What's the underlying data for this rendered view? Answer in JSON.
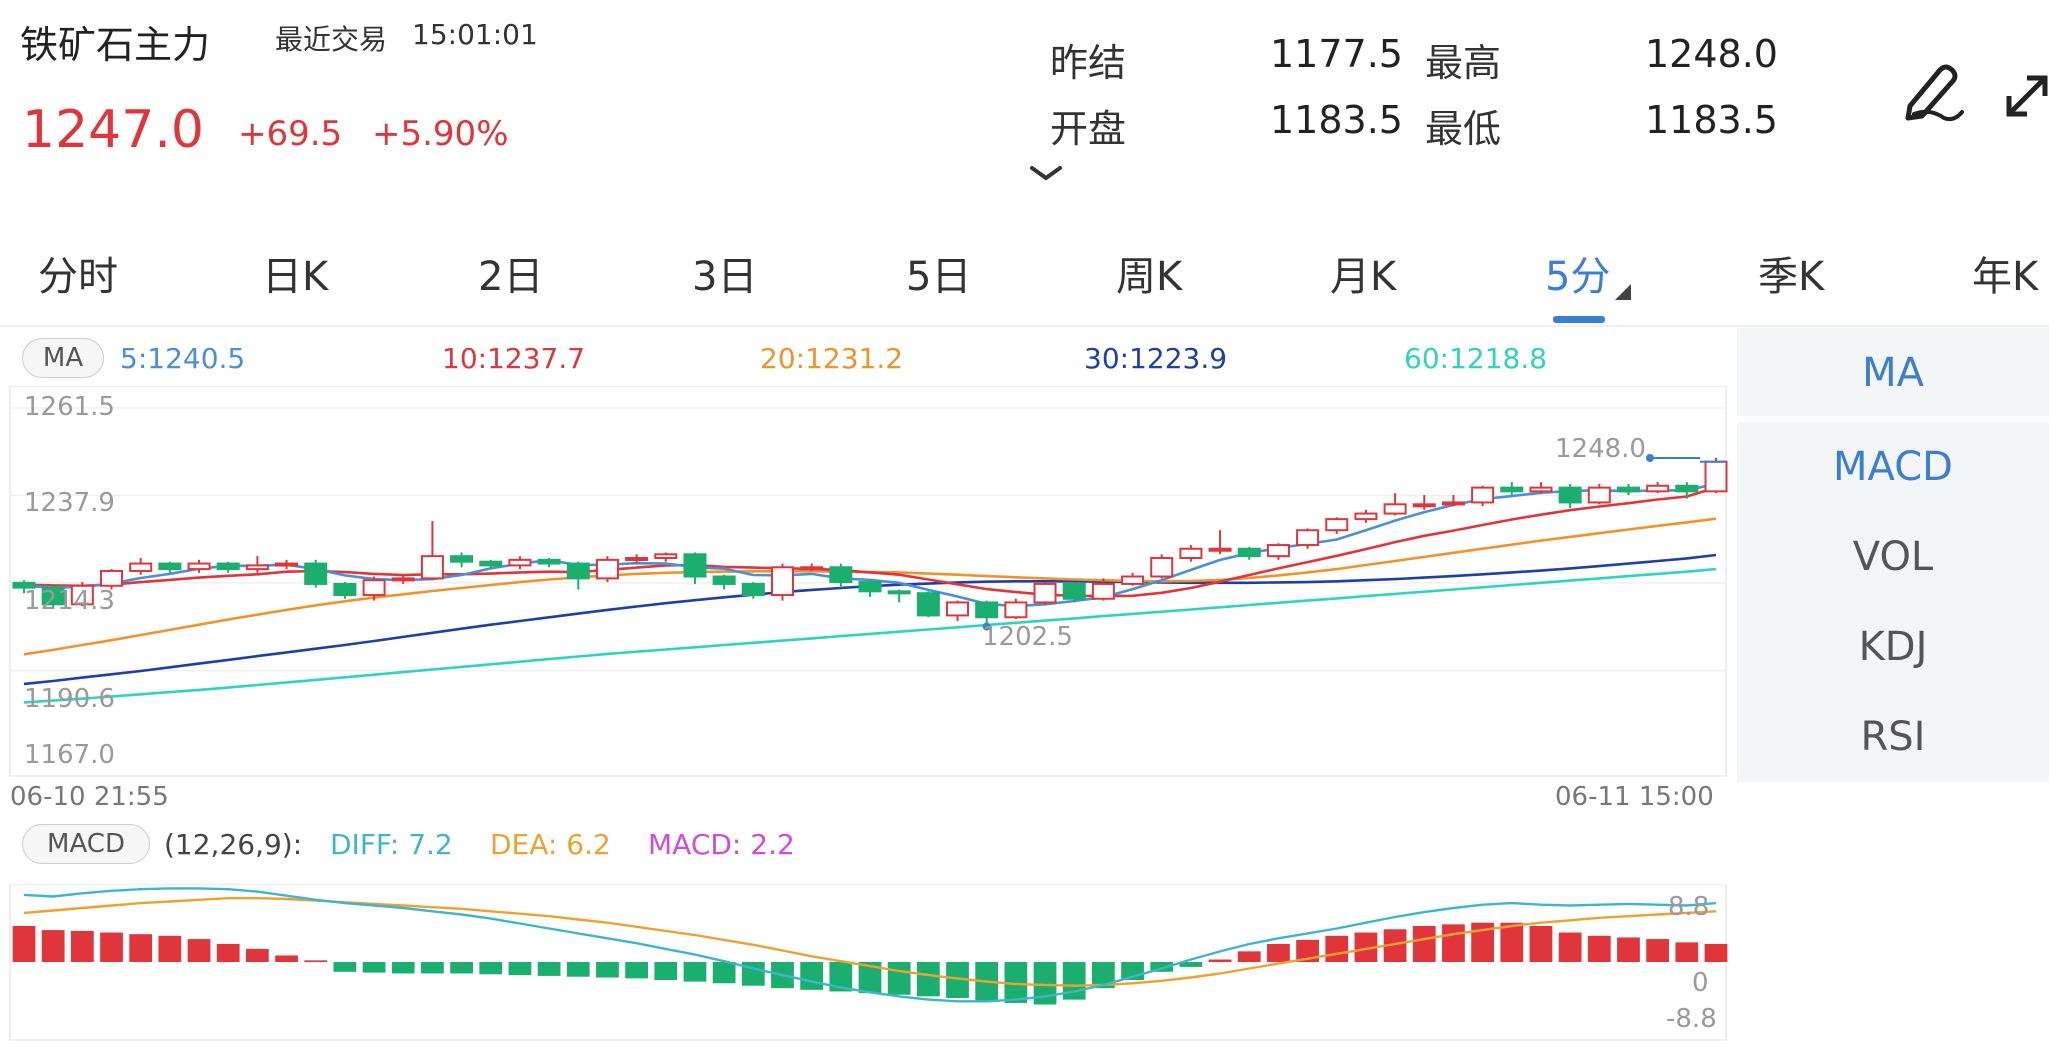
{
  "header": {
    "title": "铁矿石主力",
    "last_trade_label": "最近交易",
    "last_trade_time": "15:01:01",
    "price": "1247.0",
    "change": "+69.5",
    "change_pct": "+5.90%"
  },
  "stats": {
    "prev_settle_label": "昨结",
    "prev_settle": "1177.5",
    "high_label": "最高",
    "high": "1248.0",
    "open_label": "开盘",
    "open": "1183.5",
    "low_label": "最低",
    "low": "1183.5"
  },
  "tabs": [
    {
      "label": "分时"
    },
    {
      "label": "日K"
    },
    {
      "label": "2日"
    },
    {
      "label": "3日"
    },
    {
      "label": "5日"
    },
    {
      "label": "周K"
    },
    {
      "label": "月K"
    },
    {
      "label": "5分"
    },
    {
      "label": "季K"
    },
    {
      "label": "年K"
    }
  ],
  "active_tab": "5分",
  "indicators": {
    "main": [
      "MA"
    ],
    "sub": [
      "MACD",
      "VOL",
      "KDJ",
      "RSI"
    ]
  },
  "ma_legend": {
    "label": "MA",
    "ma5": "5:1240.5",
    "ma10": "10:1237.7",
    "ma20": "20:1231.2",
    "ma30": "30:1223.9",
    "ma60": "60:1218.8"
  },
  "price_axis": [
    "1261.5",
    "1237.9",
    "1214.3",
    "1190.6",
    "1167.0"
  ],
  "price_markers": {
    "high": "1248.0",
    "low": "1202.5"
  },
  "time_axis": {
    "start": "06-10 21:55",
    "end": "06-11 15:00"
  },
  "macd_legend": {
    "label": "MACD",
    "params": "(12,26,9):",
    "diff": "DIFF: 7.2",
    "dea": "DEA: 6.2",
    "macd": "MACD: 2.2"
  },
  "macd_axis": [
    "8.8",
    "0",
    "-8.8"
  ],
  "colors": {
    "up": "#e0353b",
    "down": "#1aae6f",
    "accent": "#3b7fd4",
    "ma5": "#4a90d9",
    "ma10": "#e0353b",
    "ma20": "#f0932b",
    "ma30": "#1f3fa8",
    "ma60": "#2dd4bf",
    "diff": "#3fb6c8",
    "dea": "#f0a030",
    "macd": "#d24ad6"
  },
  "chart_data": {
    "type": "candlestick",
    "price_ylim": [
      1167.0,
      1261.5
    ],
    "macd_ylim": [
      -8.8,
      8.8
    ],
    "candles": [
      [
        1214.3,
        1213.0,
        1215.0,
        1211.5
      ],
      [
        1213.0,
        1208.5,
        1213.5,
        1207.5
      ],
      [
        1208.5,
        1213.5,
        1214.5,
        1208.0
      ],
      [
        1213.5,
        1217.5,
        1218.0,
        1212.5
      ],
      [
        1217.5,
        1219.5,
        1221.0,
        1216.5
      ],
      [
        1219.5,
        1218.0,
        1220.0,
        1217.0
      ],
      [
        1218.0,
        1219.5,
        1220.5,
        1217.0
      ],
      [
        1219.5,
        1218.0,
        1220.0,
        1217.0
      ],
      [
        1218.0,
        1219.0,
        1221.5,
        1217.0
      ],
      [
        1219.0,
        1219.5,
        1220.5,
        1218.0
      ],
      [
        1219.5,
        1214.0,
        1220.5,
        1213.0
      ],
      [
        1214.0,
        1211.0,
        1214.5,
        1210.0
      ],
      [
        1211.0,
        1215.0,
        1216.0,
        1209.5
      ],
      [
        1215.0,
        1215.5,
        1216.5,
        1214.0
      ],
      [
        1215.5,
        1221.5,
        1231.0,
        1215.0
      ],
      [
        1221.5,
        1220.0,
        1222.5,
        1218.5
      ],
      [
        1220.0,
        1219.0,
        1220.5,
        1218.0
      ],
      [
        1219.0,
        1220.5,
        1221.5,
        1218.0
      ],
      [
        1220.5,
        1219.5,
        1221.0,
        1218.5
      ],
      [
        1219.5,
        1215.5,
        1220.0,
        1212.5
      ],
      [
        1215.5,
        1220.5,
        1221.5,
        1214.5
      ],
      [
        1220.5,
        1221.0,
        1222.0,
        1219.5
      ],
      [
        1221.0,
        1222.0,
        1222.5,
        1220.0
      ],
      [
        1222.0,
        1216.0,
        1222.5,
        1214.0
      ],
      [
        1216.0,
        1214.0,
        1216.5,
        1212.5
      ],
      [
        1214.0,
        1211.0,
        1214.5,
        1210.0
      ],
      [
        1211.0,
        1218.5,
        1219.5,
        1209.5
      ],
      [
        1218.5,
        1218.5,
        1219.5,
        1217.5
      ],
      [
        1218.5,
        1214.5,
        1219.5,
        1213.0
      ],
      [
        1214.5,
        1212.0,
        1215.0,
        1210.5
      ],
      [
        1212.0,
        1211.5,
        1212.5,
        1209.0
      ],
      [
        1211.5,
        1205.5,
        1212.0,
        1205.0
      ],
      [
        1205.5,
        1209.0,
        1209.5,
        1204.0
      ],
      [
        1209.0,
        1205.0,
        1209.5,
        1202.5
      ],
      [
        1205.0,
        1209.0,
        1210.0,
        1204.5
      ],
      [
        1209.0,
        1214.0,
        1214.5,
        1208.5
      ],
      [
        1214.0,
        1210.0,
        1214.5,
        1209.0
      ],
      [
        1210.0,
        1214.0,
        1215.5,
        1209.5
      ],
      [
        1214.0,
        1216.0,
        1217.0,
        1213.5
      ],
      [
        1216.0,
        1221.0,
        1222.0,
        1215.5
      ],
      [
        1221.0,
        1223.5,
        1224.5,
        1220.0
      ],
      [
        1223.5,
        1223.5,
        1228.5,
        1222.0
      ],
      [
        1223.5,
        1221.5,
        1224.0,
        1220.5
      ],
      [
        1221.5,
        1224.5,
        1225.0,
        1220.5
      ],
      [
        1224.5,
        1228.5,
        1229.0,
        1223.5
      ],
      [
        1228.5,
        1231.5,
        1232.0,
        1227.5
      ],
      [
        1231.5,
        1233.0,
        1234.0,
        1230.5
      ],
      [
        1233.0,
        1235.5,
        1238.5,
        1232.5
      ],
      [
        1235.5,
        1235.5,
        1238.0,
        1234.0
      ],
      [
        1235.5,
        1236.0,
        1238.0,
        1235.0
      ],
      [
        1236.0,
        1240.0,
        1240.5,
        1235.0
      ],
      [
        1240.0,
        1239.0,
        1241.5,
        1238.0
      ],
      [
        1239.0,
        1240.0,
        1241.5,
        1238.5
      ],
      [
        1240.0,
        1236.0,
        1241.0,
        1234.5
      ],
      [
        1236.0,
        1240.0,
        1241.0,
        1235.5
      ],
      [
        1240.0,
        1239.0,
        1241.0,
        1238.0
      ],
      [
        1239.0,
        1240.5,
        1241.5,
        1238.5
      ],
      [
        1240.5,
        1239.0,
        1241.5,
        1237.0
      ],
      [
        1239.0,
        1247.0,
        1248.0,
        1238.5
      ]
    ],
    "ma5": [
      1213.5,
      1213.0,
      1213.2,
      1214.1,
      1215.6,
      1216.7,
      1218.1,
      1218.9,
      1218.9,
      1219.2,
      1218.0,
      1216.3,
      1215.3,
      1215.0,
      1215.3,
      1216.4,
      1218.2,
      1219.5,
      1220.4,
      1219.1,
      1219.2,
      1219.6,
      1219.5,
      1218.5,
      1218.1,
      1216.4,
      1216.3,
      1216.7,
      1215.5,
      1215.1,
      1214.3,
      1212.4,
      1210.6,
      1208.6,
      1208.0,
      1208.5,
      1209.4,
      1210.4,
      1212.6,
      1215.0,
      1217.8,
      1220.5,
      1222.3,
      1223.7,
      1224.8,
      1226.0,
      1228.5,
      1231.1,
      1233.4,
      1235.3,
      1236.9,
      1237.7,
      1238.6,
      1239.1,
      1239.3,
      1239.0,
      1239.3,
      1239.2,
      1241.1
    ],
    "ma10": [
      1213.8,
      1213.6,
      1213.5,
      1213.8,
      1214.5,
      1215.1,
      1215.7,
      1216.2,
      1216.6,
      1217.3,
      1217.5,
      1217.2,
      1216.7,
      1216.4,
      1216.6,
      1216.6,
      1216.8,
      1217.1,
      1217.3,
      1217.2,
      1217.8,
      1218.4,
      1219.0,
      1219.1,
      1218.6,
      1218.4,
      1218.2,
      1218.1,
      1217.7,
      1217.1,
      1216.5,
      1215.2,
      1213.9,
      1212.6,
      1211.8,
      1211.1,
      1210.8,
      1210.7,
      1210.8,
      1211.6,
      1212.9,
      1214.6,
      1216.4,
      1218.2,
      1219.9,
      1221.6,
      1223.4,
      1225.3,
      1227.0,
      1228.4,
      1229.9,
      1231.4,
      1232.7,
      1233.9,
      1234.9,
      1235.8,
      1236.8,
      1237.6,
      1240.0
    ],
    "ma20": [
      1195.0,
      1196.2,
      1197.5,
      1198.8,
      1200.2,
      1201.6,
      1203.0,
      1204.4,
      1205.7,
      1207.0,
      1208.2,
      1209.3,
      1210.3,
      1211.2,
      1212.1,
      1212.9,
      1213.7,
      1214.5,
      1215.2,
      1215.8,
      1216.3,
      1216.7,
      1217.0,
      1217.2,
      1217.3,
      1217.4,
      1217.4,
      1217.4,
      1217.3,
      1217.2,
      1217.1,
      1216.8,
      1216.5,
      1216.1,
      1215.8,
      1215.5,
      1215.2,
      1215.0,
      1214.8,
      1214.7,
      1214.8,
      1215.1,
      1215.6,
      1216.3,
      1217.1,
      1218.0,
      1219.1,
      1220.2,
      1221.3,
      1222.4,
      1223.5,
      1224.6,
      1225.7,
      1226.7,
      1227.7,
      1228.7,
      1229.7,
      1230.6,
      1231.6
    ],
    "ma30": [
      1187.0,
      1187.8,
      1188.7,
      1189.6,
      1190.5,
      1191.5,
      1192.5,
      1193.5,
      1194.5,
      1195.5,
      1196.5,
      1197.5,
      1198.6,
      1199.7,
      1200.8,
      1201.9,
      1203.0,
      1204.0,
      1205.0,
      1206.0,
      1207.0,
      1207.9,
      1208.8,
      1209.6,
      1210.4,
      1211.1,
      1211.8,
      1212.4,
      1212.9,
      1213.4,
      1213.8,
      1214.1,
      1214.4,
      1214.6,
      1214.7,
      1214.7,
      1214.7,
      1214.6,
      1214.5,
      1214.4,
      1214.3,
      1214.3,
      1214.3,
      1214.4,
      1214.5,
      1214.7,
      1215.0,
      1215.3,
      1215.7,
      1216.1,
      1216.6,
      1217.1,
      1217.6,
      1218.2,
      1218.8,
      1219.5,
      1220.2,
      1220.9,
      1221.8
    ],
    "ma60": [
      1182.0,
      1182.5,
      1183.0,
      1183.6,
      1184.2,
      1184.8,
      1185.4,
      1186.0,
      1186.7,
      1187.4,
      1188.1,
      1188.8,
      1189.5,
      1190.2,
      1190.9,
      1191.6,
      1192.3,
      1193.0,
      1193.7,
      1194.4,
      1195.1,
      1195.7,
      1196.3,
      1196.9,
      1197.5,
      1198.1,
      1198.7,
      1199.3,
      1199.9,
      1200.5,
      1201.1,
      1201.7,
      1202.3,
      1202.9,
      1203.5,
      1204.1,
      1204.7,
      1205.3,
      1205.9,
      1206.5,
      1207.1,
      1207.7,
      1208.3,
      1208.9,
      1209.5,
      1210.1,
      1210.7,
      1211.3,
      1211.9,
      1212.5,
      1213.1,
      1213.7,
      1214.3,
      1214.9,
      1215.5,
      1216.1,
      1216.7,
      1217.3,
      1218.0
    ],
    "diff": [
      8.2,
      8.0,
      8.4,
      8.7,
      8.9,
      9.0,
      9.0,
      8.9,
      8.6,
      8.1,
      7.6,
      7.2,
      6.9,
      6.6,
      6.2,
      5.8,
      5.3,
      4.7,
      4.1,
      3.5,
      2.9,
      2.3,
      1.6,
      0.9,
      0.1,
      -0.8,
      -1.6,
      -2.4,
      -3.1,
      -3.7,
      -4.2,
      -4.6,
      -4.8,
      -4.8,
      -4.6,
      -4.2,
      -3.6,
      -2.8,
      -1.8,
      -0.8,
      0.3,
      1.3,
      2.2,
      2.9,
      3.5,
      4.1,
      4.8,
      5.5,
      6.1,
      6.6,
      7.0,
      7.2,
      7.0,
      6.9,
      7.0,
      7.1,
      7.0,
      6.9,
      7.2
    ],
    "dea": [
      6.0,
      6.3,
      6.6,
      6.9,
      7.2,
      7.4,
      7.6,
      7.8,
      7.8,
      7.7,
      7.5,
      7.3,
      7.1,
      6.9,
      6.7,
      6.5,
      6.2,
      5.9,
      5.6,
      5.2,
      4.8,
      4.3,
      3.8,
      3.3,
      2.7,
      2.1,
      1.4,
      0.7,
      0.1,
      -0.5,
      -1.1,
      -1.6,
      -2.0,
      -2.4,
      -2.7,
      -2.8,
      -2.9,
      -2.8,
      -2.6,
      -2.3,
      -1.9,
      -1.4,
      -0.8,
      -0.2,
      0.4,
      1.0,
      1.6,
      2.2,
      2.8,
      3.4,
      3.9,
      4.4,
      4.8,
      5.1,
      5.4,
      5.6,
      5.8,
      6.0,
      6.2
    ],
    "macd": [
      4.4,
      3.9,
      3.8,
      3.6,
      3.4,
      3.2,
      2.8,
      2.2,
      1.6,
      0.8,
      0.2,
      -1.2,
      -1.3,
      -1.4,
      -1.4,
      -1.4,
      -1.5,
      -1.6,
      -1.7,
      -1.8,
      -1.9,
      -2.0,
      -2.2,
      -2.4,
      -2.6,
      -2.9,
      -3.2,
      -3.4,
      -3.6,
      -3.8,
      -4.0,
      -4.2,
      -4.4,
      -4.8,
      -5.0,
      -5.2,
      -4.6,
      -3.2,
      -2.2,
      -1.2,
      -0.6,
      0.3,
      1.3,
      2.2,
      2.7,
      3.2,
      3.6,
      4.0,
      4.4,
      4.6,
      4.8,
      4.8,
      4.4,
      3.6,
      3.2,
      3.0,
      2.8,
      2.4,
      2.2
    ]
  }
}
